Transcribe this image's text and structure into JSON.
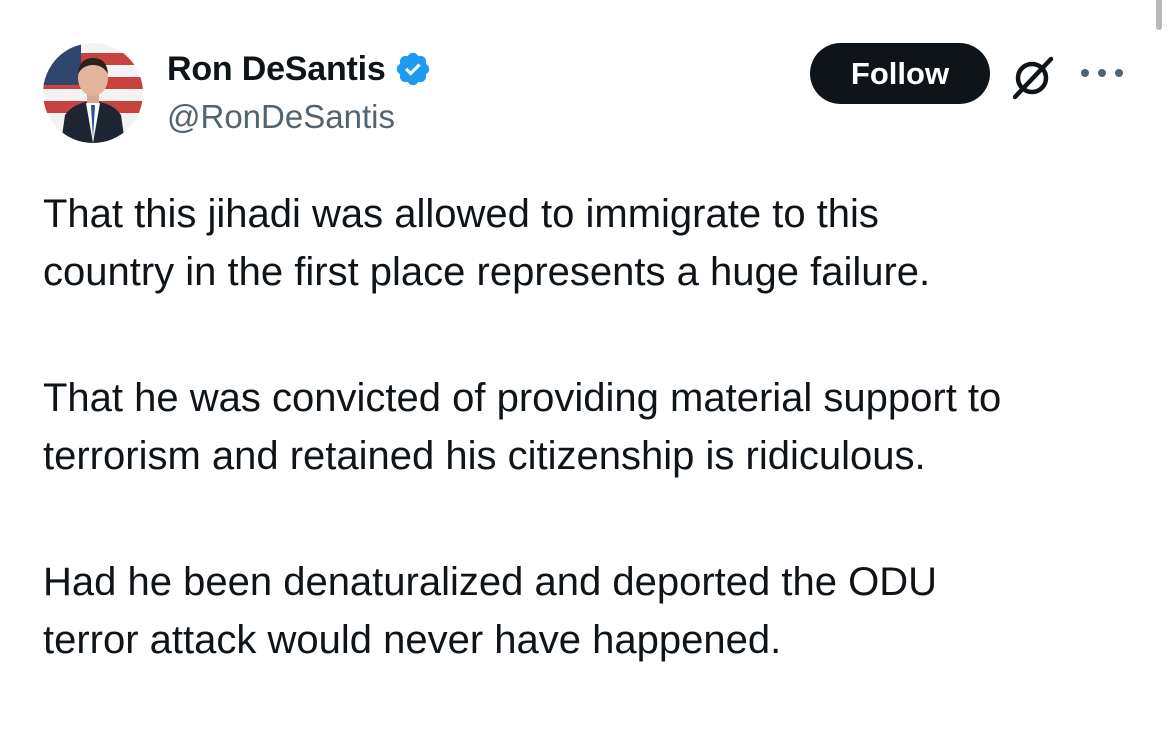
{
  "author": {
    "display_name": "Ron DeSantis",
    "handle": "@RonDeSantis",
    "verified": true,
    "avatar_icon": "profile-photo"
  },
  "actions": {
    "follow_label": "Follow",
    "grok_icon": "grok-icon",
    "more_icon": "more-options-icon"
  },
  "tweet": {
    "paragraphs": [
      "That this jihadi was allowed to immigrate to this\ncountry in the first place represents a huge failure.",
      "That he was convicted of providing material support to\nterrorism and retained his citizenship is ridiculous.",
      "Had he been denaturalized and deported the ODU\nterror attack would never have happened."
    ]
  },
  "colors": {
    "text_primary": "#0f1419",
    "text_secondary": "#536471",
    "verified_blue": "#1d9bf0",
    "follow_bg": "#0f1419",
    "follow_text": "#ffffff"
  }
}
